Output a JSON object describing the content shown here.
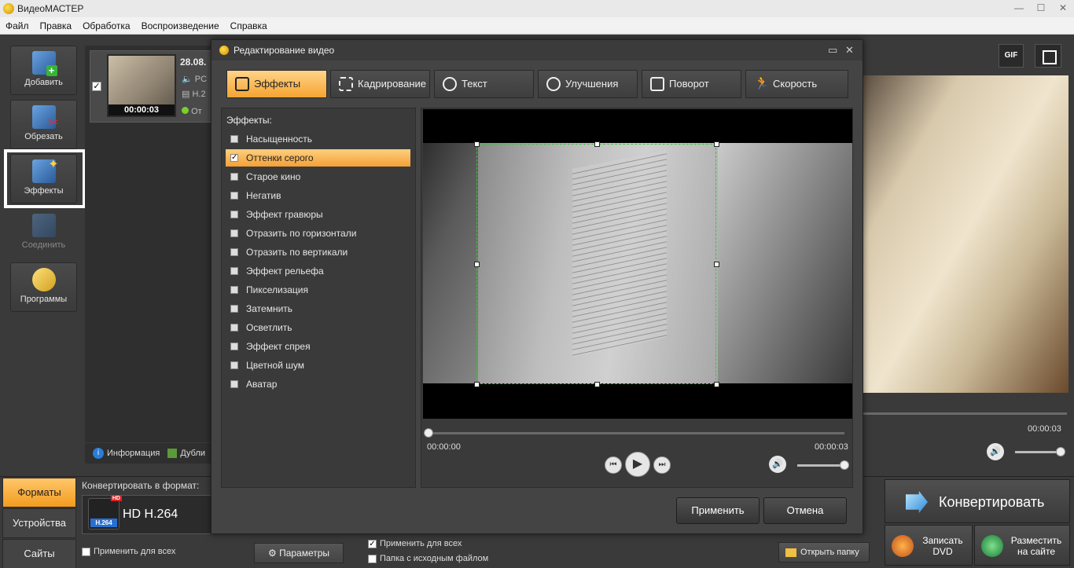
{
  "app": {
    "title": "ВидеоМАСТЕР"
  },
  "menu": [
    "Файл",
    "Правка",
    "Обработка",
    "Воспроизведение",
    "Справка"
  ],
  "left_toolbar": {
    "add": "Добавить",
    "trim": "Обрезать",
    "effects": "Эффекты",
    "join": "Соединить",
    "programs": "Программы"
  },
  "file": {
    "name": "28.08.",
    "line2": "PC",
    "line3": "H.2",
    "line4": "От",
    "duration": "00:00:03"
  },
  "info_bar": {
    "info": "Информация",
    "dup": "Дубли"
  },
  "right_preview": {
    "gif": "GIF",
    "time": "00:00:03"
  },
  "dialog": {
    "title": "Редактирование видео",
    "tabs": {
      "effects": "Эффекты",
      "crop": "Кадрирование",
      "text": "Текст",
      "enhance": "Улучшения",
      "rotate": "Поворот",
      "speed": "Скорость"
    },
    "effects_label": "Эффекты:",
    "effects": [
      "Насыщенность",
      "Оттенки серого",
      "Старое кино",
      "Негатив",
      "Эффект гравюры",
      "Отразить по горизонтали",
      "Отразить по вертикали",
      "Эффект рельефа",
      "Пикселизация",
      "Затемнить",
      "Осветлить",
      "Эффект спрея",
      "Цветной шум",
      "Аватар"
    ],
    "selected_effect": "Оттенки серого",
    "time_start": "00:00:00",
    "time_end": "00:00:03",
    "apply": "Применить",
    "cancel": "Отмена"
  },
  "bottom": {
    "tabs": {
      "formats": "Форматы",
      "devices": "Устройства",
      "sites": "Сайты"
    },
    "convert_to_label": "Конвертировать в формат:",
    "format_name": "HD H.264",
    "format_tag": "H.264",
    "format_hd": "HD",
    "apply_all_left": "Применить для всех",
    "params": "Параметры",
    "apply_all_right": "Применить для всех",
    "source_folder": "Папка с исходным файлом",
    "open_folder": "Открыть папку",
    "convert": "Конвертировать",
    "burn_dvd_1": "Записать",
    "burn_dvd_2": "DVD",
    "upload_1": "Разместить",
    "upload_2": "на сайте"
  },
  "colors": {
    "accent_orange": "#f5a430",
    "crop_border": "#3fc23f",
    "panel_dark": "#3a3a3a"
  }
}
